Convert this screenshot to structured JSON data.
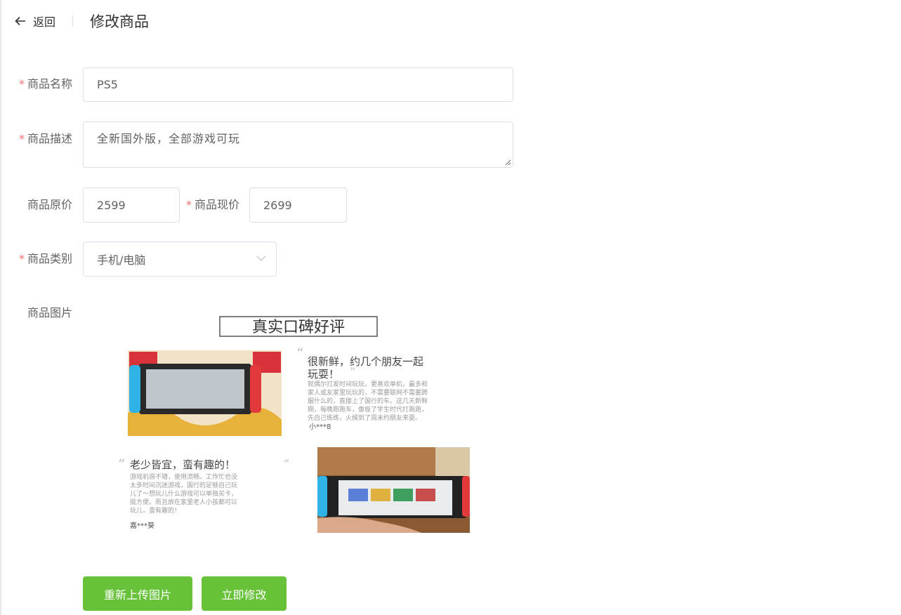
{
  "header": {
    "back_label": "返回",
    "title": "修改商品"
  },
  "form": {
    "name": {
      "label": "商品名称",
      "value": "PS5",
      "required": true
    },
    "description": {
      "label": "商品描述",
      "value": "全新国外版，全部游戏可玩",
      "required": true
    },
    "original_price": {
      "label": "商品原价",
      "value": "2599",
      "required": false
    },
    "current_price": {
      "label": "商品现价",
      "value": "2699",
      "required": true
    },
    "category": {
      "label": "商品类别",
      "selected": "手机/电脑",
      "required": true
    },
    "image": {
      "label": "商品图片"
    }
  },
  "product_image": {
    "banner": "真实口碑好评",
    "review1": {
      "title": "很新鲜，约几个朋友一起玩耍！",
      "body": "就偶尔打发时间玩玩，更喜欢单机，最多和家人或友家里玩玩的，不需要联网不需要跨服什么的，直接上了国行的车。这几天新鲜期，每晚跑跑车，像极了学生时代打跑跑，先自己练练，火候到了周末约朋友来耍。",
      "author": "小***8"
    },
    "review2": {
      "title": "老少皆宜，蛮有趣的！",
      "body": "游戏机很不错，使用流畅。工作忙也没太多时间沉迷游戏，国行的足够自己玩儿了～想玩儿什么游戏可以单独买卡，挺方便。而且放在家里老人小孩都可以玩儿，蛮有趣的！",
      "author": "嘉***葵"
    }
  },
  "buttons": {
    "reupload": "重新上传图片",
    "submit": "立即修改"
  },
  "colors": {
    "primary_green": "#67c23a",
    "required_star": "#f56c6c",
    "border": "#dcdfe6"
  }
}
